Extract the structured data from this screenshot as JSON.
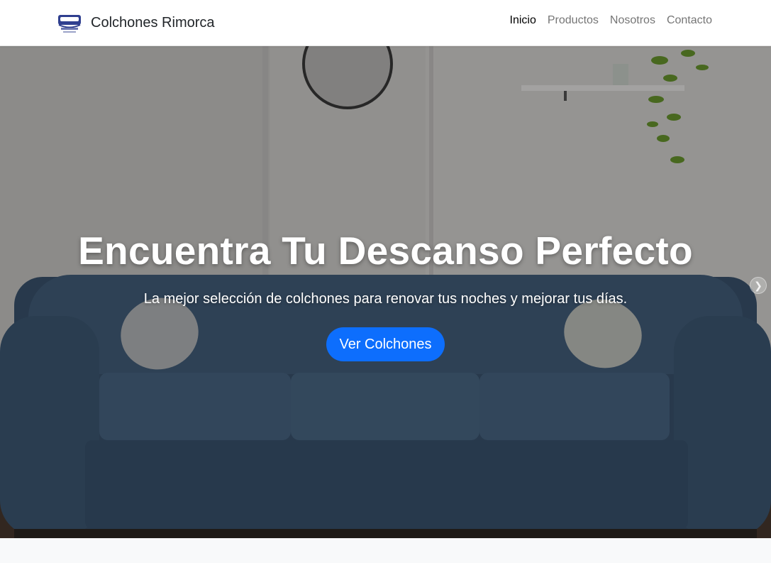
{
  "navbar": {
    "brand_name": "Colchones Rimorca",
    "links": [
      {
        "label": "Inicio",
        "active": true
      },
      {
        "label": "Productos",
        "active": false
      },
      {
        "label": "Nosotros",
        "active": false
      },
      {
        "label": "Contacto",
        "active": false
      }
    ]
  },
  "hero": {
    "title": "Encuentra Tu Descanso Perfecto",
    "subtitle": "La mejor selección de colchones para renovar tus noches y mejorar tus días.",
    "button_label": "Ver Colchones",
    "next_icon": "chevron-right-icon"
  },
  "colors": {
    "primary": "#0d6efd",
    "sofa": "#3d5772",
    "wall": "#d9d7d5"
  }
}
